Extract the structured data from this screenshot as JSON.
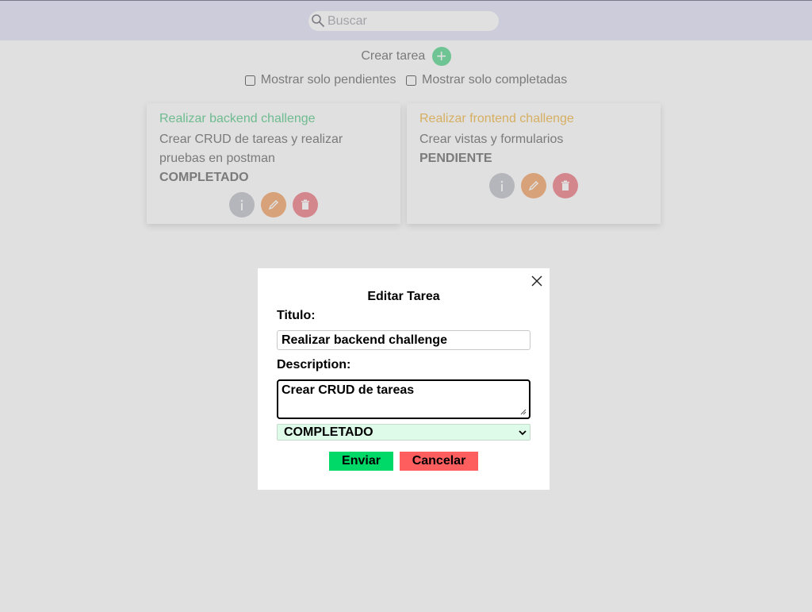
{
  "search": {
    "placeholder": "Buscar",
    "icon": "search-icon"
  },
  "toolbar": {
    "create_label": "Crear tarea",
    "create_icon": "plus-icon",
    "create_symbol": "+"
  },
  "filters": [
    {
      "label": "Mostrar solo pendientes",
      "checked": false
    },
    {
      "label": "Mostrar solo completadas",
      "checked": false
    }
  ],
  "tasks": [
    {
      "title": "Realizar backend challenge",
      "description": "Crear CRUD de tareas y realizar pruebas en postman",
      "status": "COMPLETADO",
      "title_color": "#7ed6a4"
    },
    {
      "title": "Realizar frontend challenge",
      "description": "Crear vistas y formularios",
      "status": "PENDIENTE",
      "title_color": "#f4c870"
    }
  ],
  "modal": {
    "title": "Editar Tarea",
    "title_label": "Titulo:",
    "title_value": "Realizar backend challenge",
    "description_label": "Description:",
    "description_value": "Crear CRUD de tareas",
    "status_value": "COMPLETADO",
    "submit_label": "Enviar",
    "cancel_label": "Cancelar",
    "submit_color": "#00d967",
    "cancel_color": "#ff5e5e"
  },
  "colors": {
    "topbar": "#e9e9f9",
    "accent_green": "#7fe0a8",
    "select_bg": "#ddfbe8"
  }
}
